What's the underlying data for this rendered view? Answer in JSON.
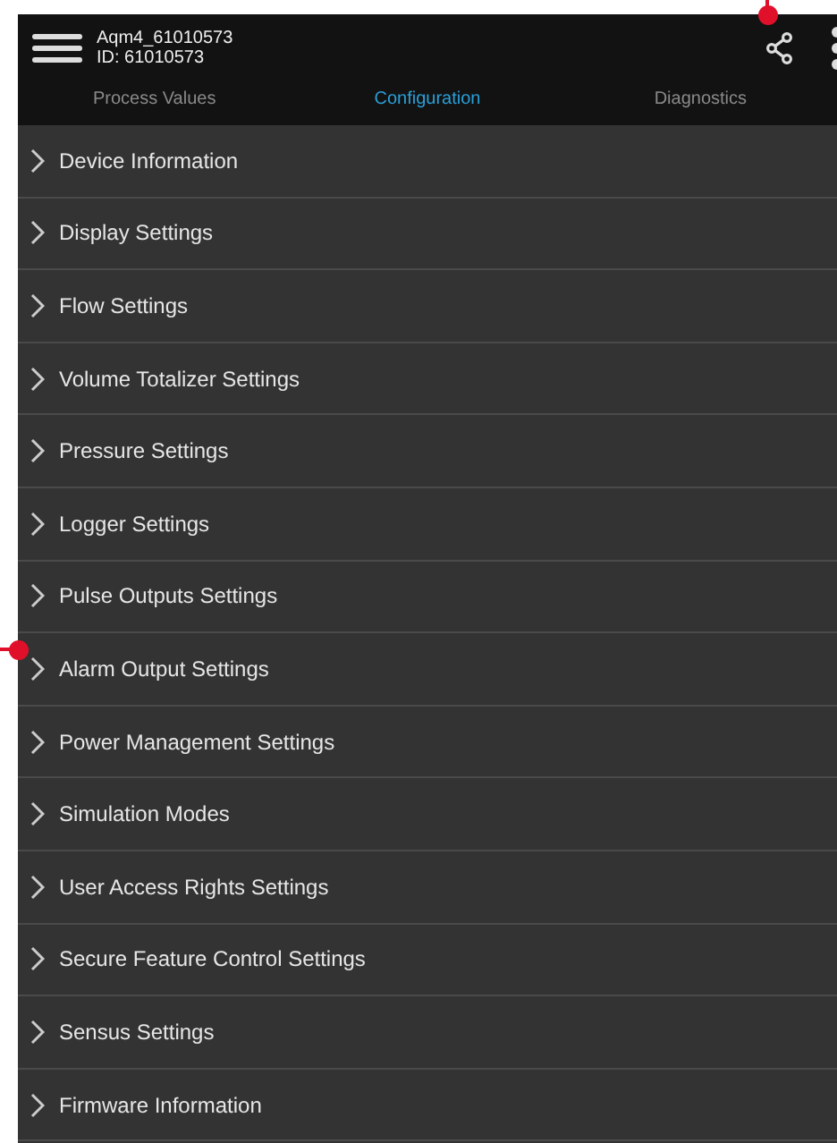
{
  "header": {
    "device_name": "Aqm4_61010573",
    "device_id": "ID: 61010573"
  },
  "tabs": [
    {
      "label": "Process Values",
      "selected": false
    },
    {
      "label": "Configuration",
      "selected": true
    },
    {
      "label": "Diagnostics",
      "selected": false
    }
  ],
  "menu_items": [
    "Device Information",
    "Display Settings",
    "Flow Settings",
    "Volume Totalizer Settings",
    "Pressure Settings",
    "Logger Settings",
    "Pulse Outputs Settings",
    "Alarm Output Settings",
    "Power Management Settings",
    "Simulation Modes",
    "User Access Rights Settings",
    "Secure Feature Control Settings",
    "Sensus Settings",
    "Firmware Information"
  ]
}
